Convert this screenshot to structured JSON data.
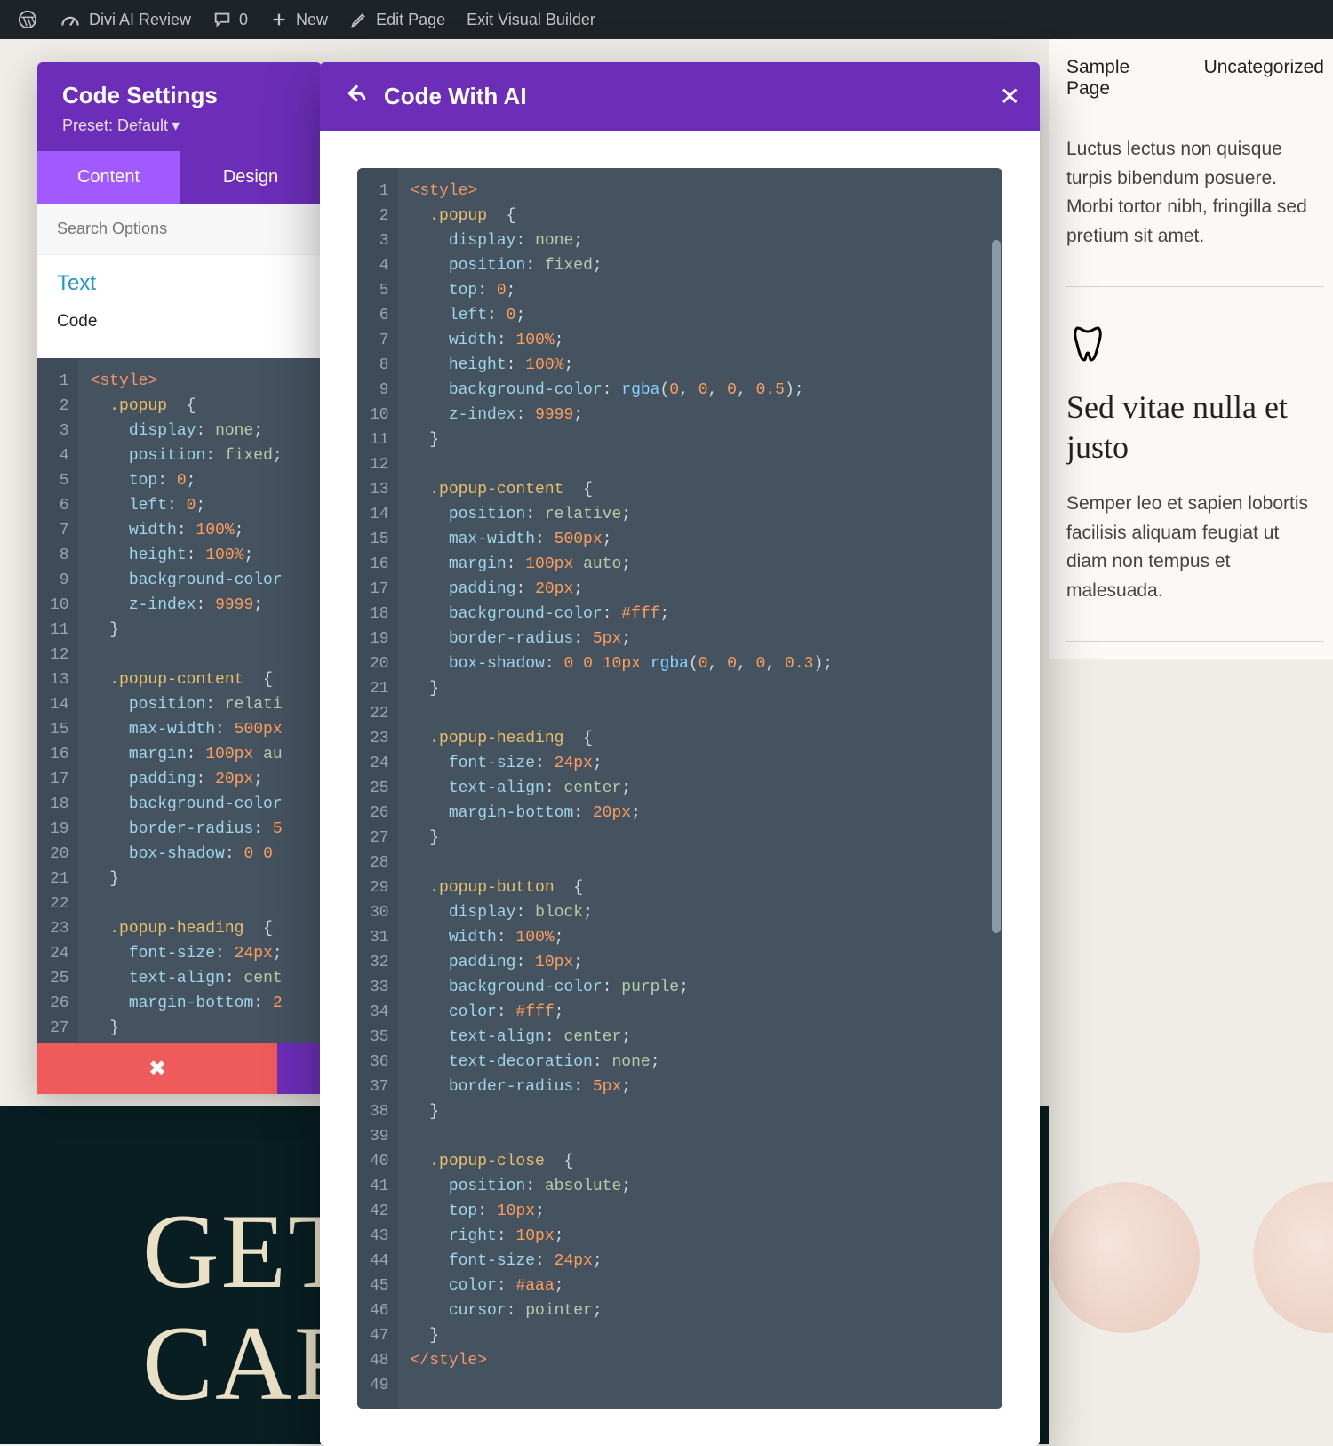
{
  "wp": {
    "site": "Divi AI Review",
    "comments": "0",
    "new": "New",
    "edit": "Edit Page",
    "exit": "Exit Visual Builder"
  },
  "nav": {
    "sample": "Sample Page",
    "uncat": "Uncategorized"
  },
  "article1": {
    "body": "Luctus lectus non quisque turpis bibendum posuere. Morbi tortor nibh, fringilla sed pretium sit amet."
  },
  "article2": {
    "title": "Sed vitae nulla et justo",
    "body": "Semper leo et sapien lobortis facilisis aliquam feugiat ut diam non tempus et malesuada."
  },
  "hero": {
    "line1": "GET",
    "line2": "CAR"
  },
  "panel": {
    "title": "Code Settings",
    "preset": "Preset: Default",
    "tab_content": "Content",
    "tab_design": "Design",
    "search_ph": "Search Options",
    "section": "Text",
    "label": "Code"
  },
  "ai": {
    "title": "Code With AI"
  },
  "code_lines": [
    {
      "n": 1,
      "html": "<span class='tok-tag'>&lt;style&gt;</span>"
    },
    {
      "n": 2,
      "html": "  <span class='tok-sel'>.popup</span>  <span class='tok-pun'>{</span>"
    },
    {
      "n": 3,
      "html": "    <span class='tok-prop'>display</span>: <span class='tok-val'>none</span>;"
    },
    {
      "n": 4,
      "html": "    <span class='tok-prop'>position</span>: <span class='tok-val'>fixed</span>;"
    },
    {
      "n": 5,
      "html": "    <span class='tok-prop'>top</span>: <span class='tok-num'>0</span>;"
    },
    {
      "n": 6,
      "html": "    <span class='tok-prop'>left</span>: <span class='tok-num'>0</span>;"
    },
    {
      "n": 7,
      "html": "    <span class='tok-prop'>width</span>: <span class='tok-num'>100%</span>;"
    },
    {
      "n": 8,
      "html": "    <span class='tok-prop'>height</span>: <span class='tok-num'>100%</span>;"
    },
    {
      "n": 9,
      "html": "    <span class='tok-prop'>background-color</span>: <span class='tok-fn'>rgba</span>(<span class='tok-num'>0</span>, <span class='tok-num'>0</span>, <span class='tok-num'>0</span>, <span class='tok-num'>0.5</span>);"
    },
    {
      "n": 10,
      "html": "    <span class='tok-prop'>z-index</span>: <span class='tok-num'>9999</span>;"
    },
    {
      "n": 11,
      "html": "  <span class='tok-pun'>}</span>"
    },
    {
      "n": 12,
      "html": ""
    },
    {
      "n": 13,
      "html": "  <span class='tok-sel'>.popup-content</span>  <span class='tok-pun'>{</span>"
    },
    {
      "n": 14,
      "html": "    <span class='tok-prop'>position</span>: <span class='tok-val'>relative</span>;"
    },
    {
      "n": 15,
      "html": "    <span class='tok-prop'>max-width</span>: <span class='tok-num'>500px</span>;"
    },
    {
      "n": 16,
      "html": "    <span class='tok-prop'>margin</span>: <span class='tok-num'>100px</span> <span class='tok-val'>auto</span>;"
    },
    {
      "n": 17,
      "html": "    <span class='tok-prop'>padding</span>: <span class='tok-num'>20px</span>;"
    },
    {
      "n": 18,
      "html": "    <span class='tok-prop'>background-color</span>: <span class='tok-num'>#fff</span>;"
    },
    {
      "n": 19,
      "html": "    <span class='tok-prop'>border-radius</span>: <span class='tok-num'>5px</span>;"
    },
    {
      "n": 20,
      "html": "    <span class='tok-prop'>box-shadow</span>: <span class='tok-num'>0</span> <span class='tok-num'>0</span> <span class='tok-num'>10px</span> <span class='tok-fn'>rgba</span>(<span class='tok-num'>0</span>, <span class='tok-num'>0</span>, <span class='tok-num'>0</span>, <span class='tok-num'>0.3</span>);"
    },
    {
      "n": 21,
      "html": "  <span class='tok-pun'>}</span>"
    },
    {
      "n": 22,
      "html": ""
    },
    {
      "n": 23,
      "html": "  <span class='tok-sel'>.popup-heading</span>  <span class='tok-pun'>{</span>"
    },
    {
      "n": 24,
      "html": "    <span class='tok-prop'>font-size</span>: <span class='tok-num'>24px</span>;"
    },
    {
      "n": 25,
      "html": "    <span class='tok-prop'>text-align</span>: <span class='tok-val'>center</span>;"
    },
    {
      "n": 26,
      "html": "    <span class='tok-prop'>margin-bottom</span>: <span class='tok-num'>20px</span>;"
    },
    {
      "n": 27,
      "html": "  <span class='tok-pun'>}</span>"
    },
    {
      "n": 28,
      "html": ""
    },
    {
      "n": 29,
      "html": "  <span class='tok-sel'>.popup-button</span>  <span class='tok-pun'>{</span>"
    },
    {
      "n": 30,
      "html": "    <span class='tok-prop'>display</span>: <span class='tok-val'>block</span>;"
    },
    {
      "n": 31,
      "html": "    <span class='tok-prop'>width</span>: <span class='tok-num'>100%</span>;"
    },
    {
      "n": 32,
      "html": "    <span class='tok-prop'>padding</span>: <span class='tok-num'>10px</span>;"
    },
    {
      "n": 33,
      "html": "    <span class='tok-prop'>background-color</span>: <span class='tok-val'>purple</span>;"
    },
    {
      "n": 34,
      "html": "    <span class='tok-prop'>color</span>: <span class='tok-num'>#fff</span>;"
    },
    {
      "n": 35,
      "html": "    <span class='tok-prop'>text-align</span>: <span class='tok-val'>center</span>;"
    },
    {
      "n": 36,
      "html": "    <span class='tok-prop'>text-decoration</span>: <span class='tok-val'>none</span>;"
    },
    {
      "n": 37,
      "html": "    <span class='tok-prop'>border-radius</span>: <span class='tok-num'>5px</span>;"
    },
    {
      "n": 38,
      "html": "  <span class='tok-pun'>}</span>"
    },
    {
      "n": 39,
      "html": ""
    },
    {
      "n": 40,
      "html": "  <span class='tok-sel'>.popup-close</span>  <span class='tok-pun'>{</span>"
    },
    {
      "n": 41,
      "html": "    <span class='tok-prop'>position</span>: <span class='tok-val'>absolute</span>;"
    },
    {
      "n": 42,
      "html": "    <span class='tok-prop'>top</span>: <span class='tok-num'>10px</span>;"
    },
    {
      "n": 43,
      "html": "    <span class='tok-prop'>right</span>: <span class='tok-num'>10px</span>;"
    },
    {
      "n": 44,
      "html": "    <span class='tok-prop'>font-size</span>: <span class='tok-num'>24px</span>;"
    },
    {
      "n": 45,
      "html": "    <span class='tok-prop'>color</span>: <span class='tok-num'>#aaa</span>;"
    },
    {
      "n": 46,
      "html": "    <span class='tok-prop'>cursor</span>: <span class='tok-val'>pointer</span>;"
    },
    {
      "n": 47,
      "html": "  <span class='tok-pun'>}</span>"
    },
    {
      "n": 48,
      "html": "<span class='tok-tag'>&lt;/style&gt;</span>"
    },
    {
      "n": 49,
      "html": ""
    }
  ],
  "panel_cut": {
    "9": "    <span class='tok-prop'>background-color</span>",
    "14": "    <span class='tok-prop'>position</span>: <span class='tok-val'>relati</span>",
    "15": "    <span class='tok-prop'>max-width</span>: <span class='tok-num'>500px</span>",
    "16": "    <span class='tok-prop'>margin</span>: <span class='tok-num'>100px</span> <span class='tok-val'>au</span>",
    "18": "    <span class='tok-prop'>background-color</span>",
    "19": "    <span class='tok-prop'>border-radius</span>: <span class='tok-num'>5</span>",
    "20": "    <span class='tok-prop'>box-shadow</span>: <span class='tok-num'>0</span> <span class='tok-num'>0</span>",
    "24": "    <span class='tok-prop'>font-size</span>: <span class='tok-num'>24px</span>;",
    "25": "    <span class='tok-prop'>text-align</span>: <span class='tok-val'>cent</span>",
    "26": "    <span class='tok-prop'>margin-bottom</span>: <span class='tok-num'>2</span>"
  }
}
